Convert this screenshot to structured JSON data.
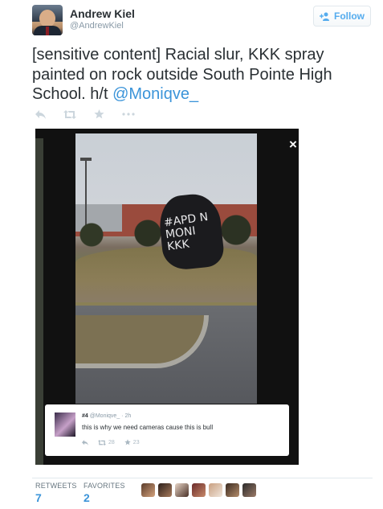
{
  "user": {
    "name": "Andrew Kiel",
    "handle": "@AndrewKiel",
    "follow_label": "Follow"
  },
  "tweet": {
    "text_plain": "[sensitive content] Racial slur, KKK spray painted on rock outside South Pointe High School. h/t ",
    "mention": "@Moniqve_"
  },
  "media": {
    "graffiti_text": "#APD N MONI KKK",
    "close_label": "×"
  },
  "embedded_tweet": {
    "name": "#4",
    "handle": "@Moniqve_",
    "time": "2h",
    "text": "this is why we need cameras cause this is bull",
    "retweets": "28",
    "favorites": "23"
  },
  "stats": {
    "retweets_label": "RETWEETS",
    "retweets_count": "7",
    "favorites_label": "FAVORITES",
    "favorites_count": "2"
  },
  "colors": {
    "link": "#3b94d9",
    "follow": "#55acee",
    "muted": "#8899a6"
  },
  "icons": [
    "reply-icon",
    "retweet-icon",
    "favorite-icon",
    "more-icon",
    "follow-user-icon"
  ]
}
